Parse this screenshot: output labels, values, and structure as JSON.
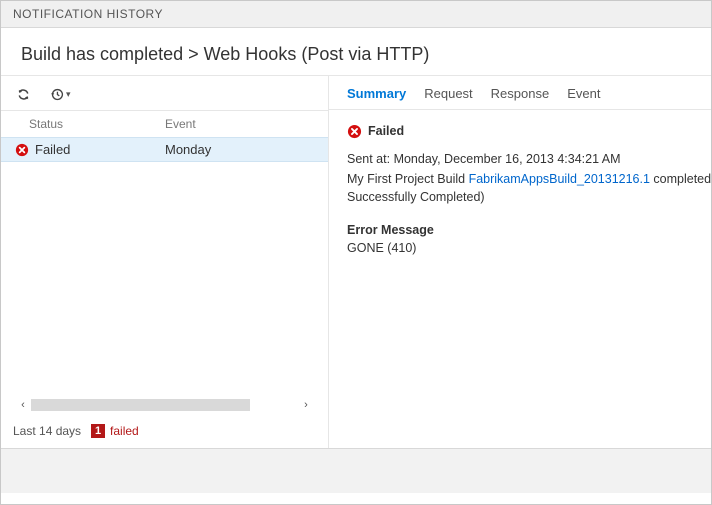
{
  "window": {
    "title": "NOTIFICATION HISTORY",
    "breadcrumb": "Build has completed > Web Hooks (Post via HTTP)"
  },
  "grid": {
    "columns": {
      "status": "Status",
      "event": "Event"
    },
    "rows": [
      {
        "status": "Failed",
        "event": "Monday"
      }
    ]
  },
  "statusbar": {
    "range": "Last 14 days",
    "failed_count": "1",
    "failed_label": "failed"
  },
  "tabs": {
    "summary": "Summary",
    "request": "Request",
    "response": "Response",
    "event": "Event"
  },
  "detail": {
    "status": "Failed",
    "sent_prefix": "Sent at: ",
    "sent_value": "Monday, December 16, 2013 4:34:21 AM",
    "line2_prefix": "My First Project Build ",
    "build_link": "FabrikamAppsBuild_20131216.1",
    "line2_suffix1": " completed (Status: Successfully Completed)",
    "line2_suffix_wrap": "Successfully Completed)",
    "error_header": "Error Message",
    "error_body": "GONE (410)"
  }
}
